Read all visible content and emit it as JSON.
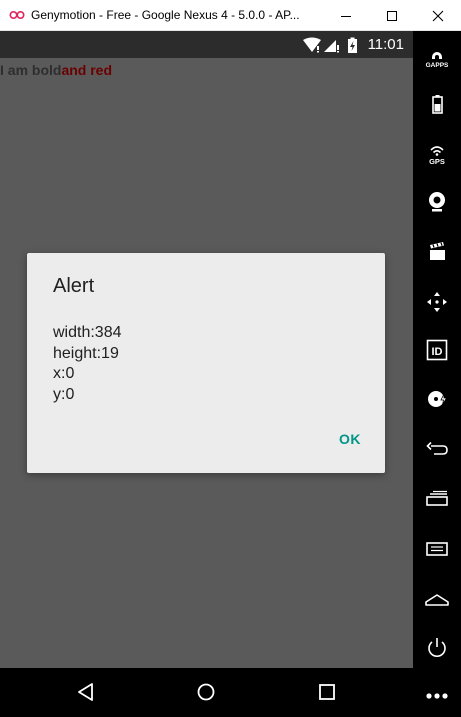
{
  "window": {
    "title": "Genymotion - Free - Google Nexus 4 - 5.0.0 - AP...",
    "icon": "genymotion-icon"
  },
  "statusbar": {
    "time": "11:01",
    "icons": [
      "wifi-icon",
      "signal-icon",
      "battery-charging-icon"
    ]
  },
  "app": {
    "text_bold": "I am bold",
    "text_red": "and red",
    "red_color": "#6b0000"
  },
  "dialog": {
    "title": "Alert",
    "lines": [
      "width:384",
      "height:19",
      "x:0",
      "y:0"
    ],
    "ok_label": "OK",
    "accent_color": "#009688"
  },
  "sidebar": {
    "tools": [
      "gapps-icon",
      "battery-icon",
      "gps-icon",
      "webcam-icon",
      "screencast-icon",
      "dpad-icon",
      "device-id-icon",
      "disk-io-icon",
      "back-icon",
      "recent-apps-icon",
      "menu-icon",
      "home-icon",
      "power-icon",
      "more-icon"
    ],
    "gapps_label": "GAPPS",
    "gps_label": "GPS",
    "id_label": "ID"
  },
  "navbar": {
    "buttons": [
      "back-triangle-icon",
      "home-circle-icon",
      "recents-square-icon"
    ]
  }
}
